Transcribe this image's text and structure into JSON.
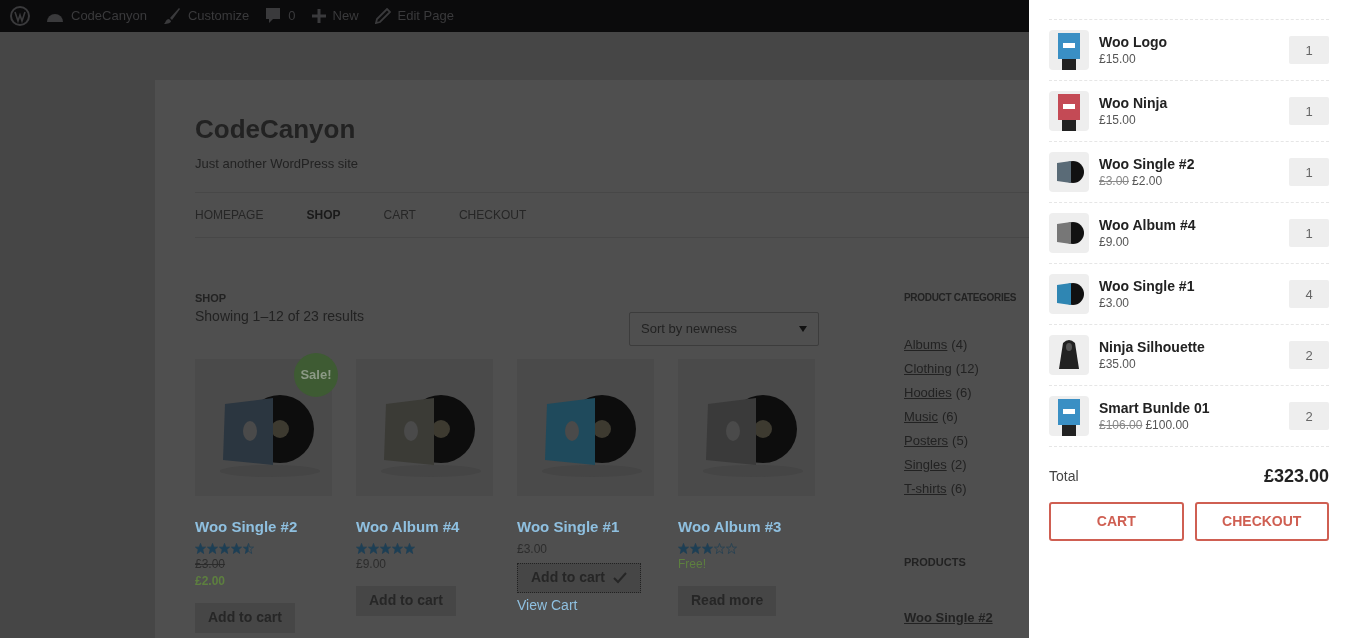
{
  "admin_bar": {
    "items": [
      {
        "kind": "logo"
      },
      {
        "kind": "site",
        "label": "CodeCanyon"
      },
      {
        "kind": "customize",
        "label": "Customize"
      },
      {
        "kind": "comments",
        "label": "0"
      },
      {
        "kind": "new",
        "label": "New"
      },
      {
        "kind": "edit",
        "label": "Edit Page"
      }
    ]
  },
  "site": {
    "title": "CodeCanyon",
    "tagline": "Just another WordPress site"
  },
  "nav": [
    {
      "label": "HOMEPAGE",
      "selected": false
    },
    {
      "label": "SHOP",
      "selected": true
    },
    {
      "label": "CART",
      "selected": false
    },
    {
      "label": "CHECKOUT",
      "selected": false
    }
  ],
  "shop": {
    "heading": "SHOP",
    "result_count": "Showing 1–12 of 23 results",
    "sort": "Sort by newness",
    "products": [
      {
        "name": "Woo Single #2",
        "stars": 4.5,
        "regular_price": "£3.00",
        "price": "£2.00",
        "kind": "sale",
        "badge": "Sale!",
        "button": "Add to cart",
        "added": false
      },
      {
        "name": "Woo Album #4",
        "stars": 5,
        "price": "£9.00",
        "kind": "normal",
        "button": "Add to cart",
        "added": false
      },
      {
        "name": "Woo Single #1",
        "price": "£3.00",
        "kind": "normal",
        "button": "Add to cart",
        "added": true,
        "view_cart": "View Cart"
      },
      {
        "name": "Woo Album #3",
        "stars": 3,
        "price": "Free!",
        "kind": "free",
        "button": "Read more",
        "added": false
      }
    ]
  },
  "sidebar": {
    "categories_title": "PRODUCT CATEGORIES",
    "categories": [
      {
        "name": "Albums",
        "count": "(4)"
      },
      {
        "name": "Clothing",
        "count": "(12)"
      },
      {
        "name": "Hoodies",
        "count": "(6)"
      },
      {
        "name": "Music",
        "count": "(6)"
      },
      {
        "name": "Posters",
        "count": "(5)"
      },
      {
        "name": "Singles",
        "count": "(2)"
      },
      {
        "name": "T-shirts",
        "count": "(6)"
      }
    ],
    "products_title": "PRODUCTS",
    "products": [
      "Woo Single #2"
    ]
  },
  "cart": {
    "items": [
      {
        "name": "Woo Logo",
        "price": "£15.00",
        "quantity": "1"
      },
      {
        "name": "Woo Ninja",
        "price": "£15.00",
        "quantity": "1"
      },
      {
        "name": "Woo Single #2",
        "regular_price": "£3.00",
        "price": "£2.00",
        "quantity": "1"
      },
      {
        "name": "Woo Album #4",
        "price": "£9.00",
        "quantity": "1"
      },
      {
        "name": "Woo Single #1",
        "price": "£3.00",
        "quantity": "4"
      },
      {
        "name": "Ninja Silhouette",
        "price": "£35.00",
        "quantity": "2"
      },
      {
        "name": "Smart Bunlde 01",
        "regular_price": "£106.00",
        "price": "£100.00",
        "quantity": "2"
      }
    ],
    "total_label": "Total",
    "total": "£323.00",
    "buttons": [
      "CART",
      "CHECKOUT"
    ]
  }
}
